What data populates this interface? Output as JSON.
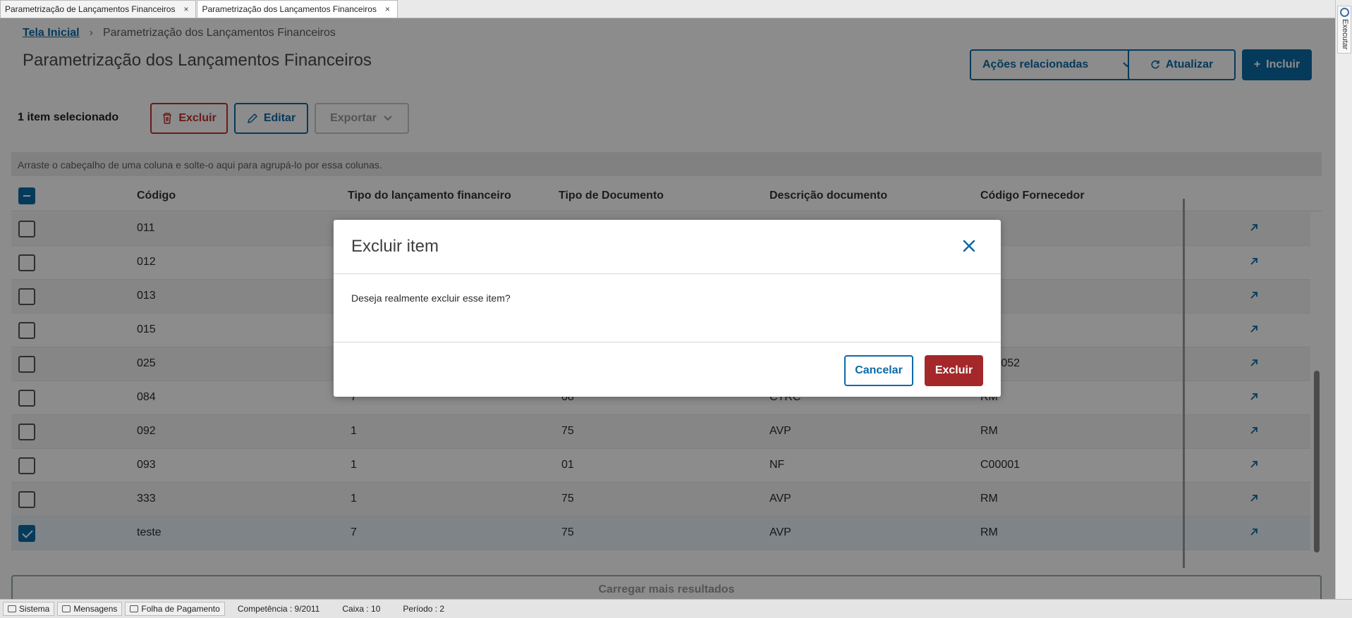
{
  "tabs": [
    {
      "label": "Parametrização de Lançamentos Financeiros",
      "close": "×"
    },
    {
      "label": "Parametrização dos Lançamentos Financeiros",
      "close": "×"
    }
  ],
  "side_tab": {
    "label": "Executar"
  },
  "breadcrumb": {
    "home": "Tela Inicial",
    "current": "Parametrização dos Lançamentos Financeiros"
  },
  "page_title": "Parametrização dos Lançamentos Financeiros",
  "header_actions": {
    "related": "Ações relacionadas",
    "refresh": "Atualizar",
    "include": "Incluir"
  },
  "selection": {
    "count_text": "1 item selecionado",
    "delete": "Excluir",
    "edit": "Editar",
    "export": "Exportar"
  },
  "group_hint": "Arraste o cabeçalho de uma coluna e solte-o aqui para agrupá-lo por essa colunas.",
  "columns": [
    "Código",
    "Tipo do lançamento financeiro",
    "Tipo de Documento",
    "Descrição documento",
    "Código Fornecedor"
  ],
  "rows": [
    {
      "codigo": "011",
      "tipo_lanc": "",
      "tipo_doc": "",
      "descricao": "",
      "fornecedor": "",
      "checked": false
    },
    {
      "codigo": "012",
      "tipo_lanc": "",
      "tipo_doc": "",
      "descricao": "",
      "fornecedor": "",
      "checked": false
    },
    {
      "codigo": "013",
      "tipo_lanc": "",
      "tipo_doc": "",
      "descricao": "",
      "fornecedor": "",
      "checked": false
    },
    {
      "codigo": "015",
      "tipo_lanc": "",
      "tipo_doc": "",
      "descricao": "",
      "fornecedor": "",
      "checked": false
    },
    {
      "codigo": "025",
      "tipo_lanc": "",
      "tipo_doc": "",
      "descricao": "",
      "fornecedor": "C00052",
      "checked": false
    },
    {
      "codigo": "084",
      "tipo_lanc": "7",
      "tipo_doc": "08",
      "descricao": "CTRC",
      "fornecedor": "RM",
      "checked": false
    },
    {
      "codigo": "092",
      "tipo_lanc": "1",
      "tipo_doc": "75",
      "descricao": "AVP",
      "fornecedor": "RM",
      "checked": false
    },
    {
      "codigo": "093",
      "tipo_lanc": "1",
      "tipo_doc": "01",
      "descricao": "NF",
      "fornecedor": "C00001",
      "checked": false
    },
    {
      "codigo": "333",
      "tipo_lanc": "1",
      "tipo_doc": "75",
      "descricao": "AVP",
      "fornecedor": "RM",
      "checked": false
    },
    {
      "codigo": "teste",
      "tipo_lanc": "7",
      "tipo_doc": "75",
      "descricao": "AVP",
      "fornecedor": "RM",
      "checked": true
    }
  ],
  "load_more": "Carregar mais resultados",
  "modal": {
    "title": "Excluir item",
    "message": "Deseja realmente excluir esse item?",
    "cancel": "Cancelar",
    "confirm": "Excluir"
  },
  "statusbar": {
    "sistema": "Sistema",
    "mensagens": "Mensagens",
    "folha": "Folha de Pagamento",
    "competencia": "Competência : 9/2011",
    "caixa": "Caixa : 10",
    "periodo": "Período : 2"
  },
  "colors": {
    "primary": "#0c6ba6",
    "danger": "#a4282a",
    "danger_outline": "#c0322f"
  }
}
